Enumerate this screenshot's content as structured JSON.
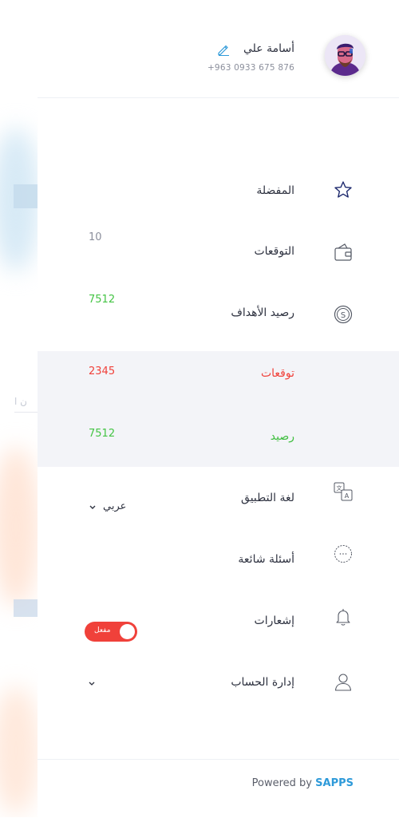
{
  "background": {
    "partial_text": "ن ا"
  },
  "profile": {
    "name": "أسامة علي",
    "phone": "+963 0933 675 876"
  },
  "menu": {
    "favorites": {
      "label": "المفضلة"
    },
    "predictions": {
      "label": "التوقعات",
      "value": "10"
    },
    "goals_balance": {
      "label": "رصيد الأهداف",
      "value": "7512"
    },
    "expectations": {
      "label": "توقعات",
      "value": "2345"
    },
    "balance": {
      "label": "رصيد",
      "value": "7512"
    },
    "app_language": {
      "label": "لغة التطبيق",
      "selected": "عربي"
    },
    "faq": {
      "label": "أسئلة شائعة"
    },
    "notifications": {
      "label": "إشعارات",
      "toggle_text": "مفعل",
      "enabled": true
    },
    "account": {
      "label": "إدارة الحساب"
    }
  },
  "footer": {
    "powered_by": "Powered by",
    "brand": "SAPPS"
  },
  "colors": {
    "accent_red": "#f0413a",
    "accent_green": "#44c444",
    "brand_blue": "#2e9ad9",
    "active_marker": "#0c1c6b",
    "highlight_bg": "#f3f4f8"
  }
}
